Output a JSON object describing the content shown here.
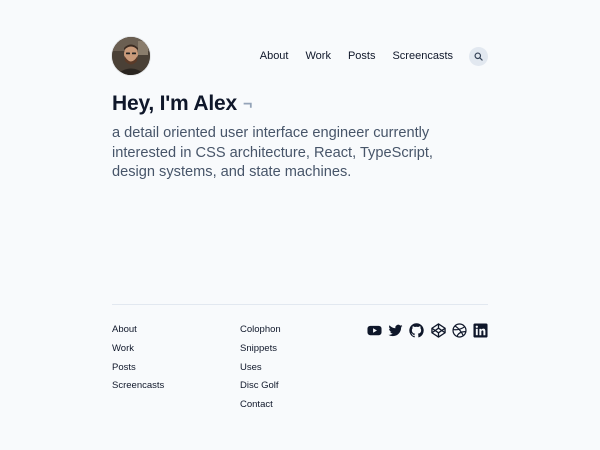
{
  "header": {
    "nav": [
      "About",
      "Work",
      "Posts",
      "Screencasts"
    ]
  },
  "hero": {
    "title": "Hey, I'm Alex",
    "title_glyph": "¬",
    "subtitle": "a detail oriented user interface engineer currently interested in CSS architecture, React, TypeScript, design systems, and state machines."
  },
  "footer": {
    "column1": [
      "About",
      "Work",
      "Posts",
      "Screencasts"
    ],
    "column2": [
      "Colophon",
      "Snippets",
      "Uses",
      "Disc Golf",
      "Contact"
    ],
    "social_icons": [
      "youtube-icon",
      "twitter-icon",
      "github-icon",
      "codepen-icon",
      "dribbble-icon",
      "linkedin-icon"
    ]
  },
  "colors": {
    "background": "#f8fafc",
    "text": "#0f172a",
    "muted": "#475569",
    "accent_glyph": "#94a3b8",
    "divider": "#e2e8f0"
  }
}
